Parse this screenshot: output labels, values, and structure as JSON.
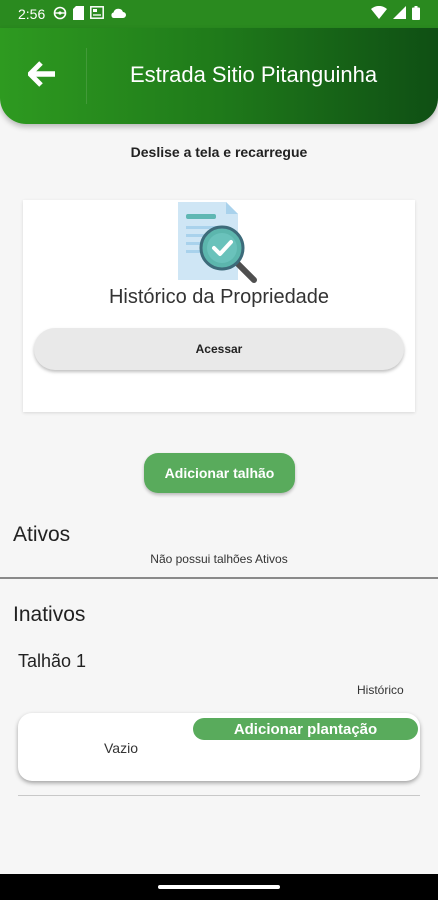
{
  "status_bar": {
    "time": "2:56",
    "left_icons": [
      "steering-icon",
      "sim-card-icon",
      "news-icon",
      "cloud-icon"
    ],
    "right_icons": [
      "wifi-icon",
      "signal-icon",
      "battery-icon"
    ]
  },
  "app_bar": {
    "back_icon": "arrow-left-icon",
    "title": "Estrada Sitio Pitanguinha",
    "gradient_colors": [
      "#2e9a20",
      "#0f4f14"
    ]
  },
  "hint": "Deslise a tela e recarregue",
  "history_card": {
    "icon": "document-check-icon",
    "title": "Histórico da Propriedade",
    "button_label": "Acessar"
  },
  "add_talhao_label": "Adicionar talhão",
  "active_section": {
    "title": "Ativos",
    "empty_text": "Não possui talhões Ativos"
  },
  "inactive_section": {
    "title": "Inativos",
    "talhoes": [
      {
        "name": "Talhão 1",
        "history_link": "Histórico",
        "crop_status": "Vazio",
        "add_plant_label": "Adicionar plantação"
      }
    ]
  },
  "colors": {
    "accent_green": "#59ab5c",
    "status_bar": "#2a8a1f"
  }
}
